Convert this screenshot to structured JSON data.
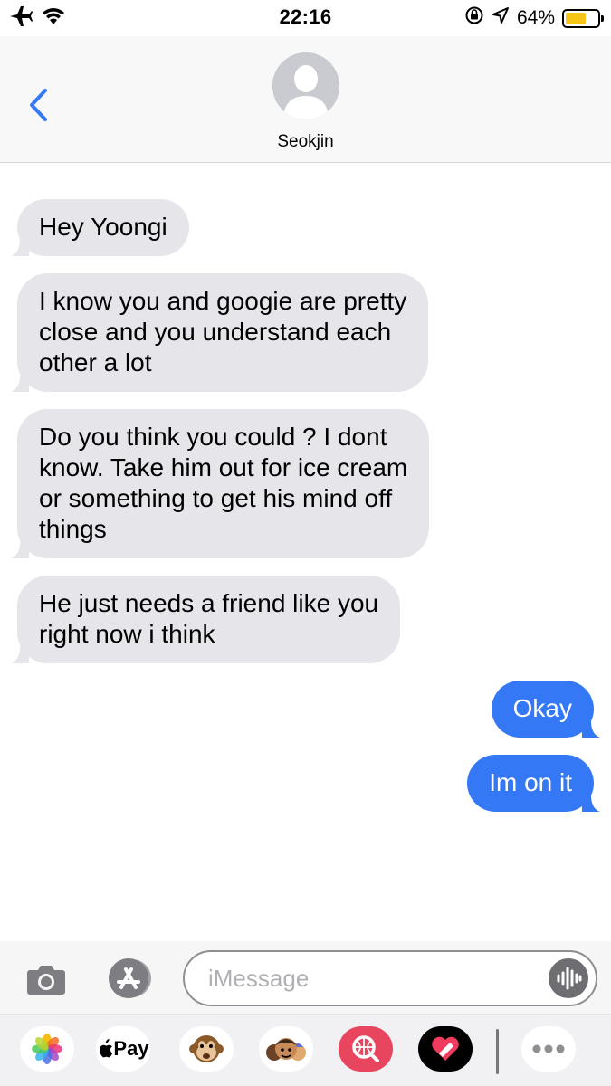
{
  "status_bar": {
    "time": "22:16",
    "battery_percent_label": "64%",
    "battery_level": 0.64,
    "icons": [
      "airplane-icon",
      "wifi-icon",
      "orientation-lock-icon",
      "location-icon",
      "battery-icon"
    ]
  },
  "header": {
    "contact_name": "Seokjin",
    "back_icon": "chevron-left-icon",
    "avatar_icon": "person-silhouette-icon"
  },
  "messages": [
    {
      "direction": "incoming",
      "lines": [
        "Hey Yoongi"
      ]
    },
    {
      "direction": "incoming",
      "lines": [
        "I know you and googie are pretty",
        "close and you understand each",
        "other a lot"
      ]
    },
    {
      "direction": "incoming",
      "lines": [
        "Do you think you could ? I dont",
        "know. Take him out for ice cream",
        "or something to get his mind off",
        "things"
      ]
    },
    {
      "direction": "incoming",
      "lines": [
        "He just needs a friend like you",
        "right now i think"
      ]
    },
    {
      "direction": "outgoing",
      "lines": [
        "Okay"
      ]
    },
    {
      "direction": "outgoing",
      "lines": [
        "Im on it"
      ]
    }
  ],
  "input_bar": {
    "placeholder": "iMessage",
    "value": "",
    "camera_icon": "camera-icon",
    "apps_icon": "app-store-icon",
    "audio_icon": "audio-waveform-icon"
  },
  "app_drawer": {
    "apple_pay_label": "Pay",
    "apps": [
      "photos-icon",
      "apple-pay-icon",
      "monkey-memoji-icon",
      "memoji-stickers-icon",
      "web-search-icon",
      "digital-touch-icon",
      "more-icon"
    ]
  },
  "colors": {
    "incoming_bubble": "#e5e5ea",
    "outgoing_bubble": "#3478f6",
    "accent": "#3478f6",
    "battery_fill": "#f5c518"
  }
}
